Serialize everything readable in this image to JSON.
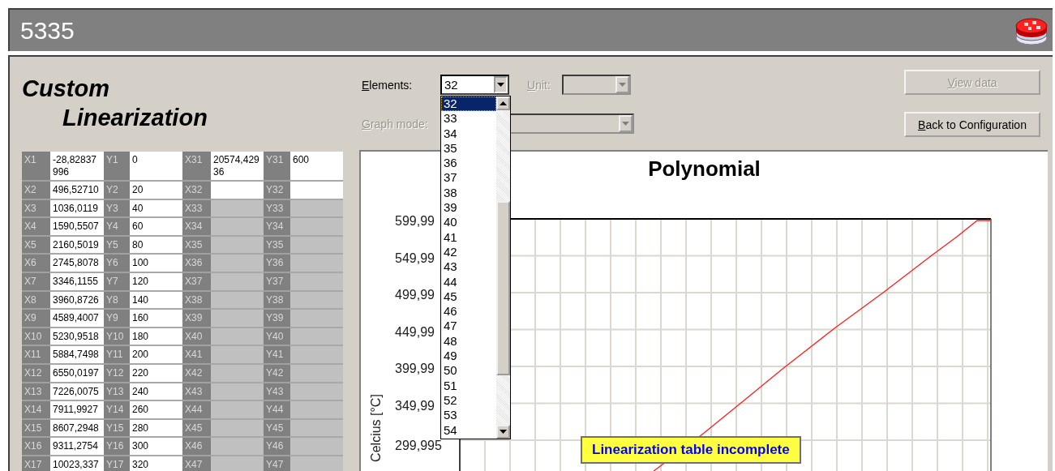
{
  "window": {
    "title": "5335"
  },
  "heading": [
    "Custom",
    "Linearization"
  ],
  "table": {
    "rows": [
      {
        "x_label": "X1",
        "x_value": "-28,82837996",
        "y_label": "Y1",
        "y_value": "0",
        "x2_label": "X31",
        "x2_value": "20574,42936",
        "y2_label": "Y31",
        "y2_value": "600",
        "right_disabled": false
      },
      {
        "x_label": "X2",
        "x_value": "496,52710",
        "y_label": "Y2",
        "y_value": "20",
        "x2_label": "X32",
        "y2_label": "Y32",
        "right_disabled": false
      },
      {
        "x_label": "X3",
        "x_value": "1036,0119",
        "y_label": "Y3",
        "y_value": "40",
        "x2_label": "X33",
        "y2_label": "Y33",
        "right_disabled": true
      },
      {
        "x_label": "X4",
        "x_value": "1590,5507",
        "y_label": "Y4",
        "y_value": "60",
        "x2_label": "X34",
        "y2_label": "Y34",
        "right_disabled": true
      },
      {
        "x_label": "X5",
        "x_value": "2160,5019",
        "y_label": "Y5",
        "y_value": "80",
        "x2_label": "X35",
        "y2_label": "Y35",
        "right_disabled": true
      },
      {
        "x_label": "X6",
        "x_value": "2745,8078",
        "y_label": "Y6",
        "y_value": "100",
        "x2_label": "X36",
        "y2_label": "Y36",
        "right_disabled": true
      },
      {
        "x_label": "X7",
        "x_value": "3346,1155",
        "y_label": "Y7",
        "y_value": "120",
        "x2_label": "X37",
        "y2_label": "Y37",
        "right_disabled": true
      },
      {
        "x_label": "X8",
        "x_value": "3960,8726",
        "y_label": "Y8",
        "y_value": "140",
        "x2_label": "X38",
        "y2_label": "Y38",
        "right_disabled": true
      },
      {
        "x_label": "X9",
        "x_value": "4589,4007",
        "y_label": "Y9",
        "y_value": "160",
        "x2_label": "X39",
        "y2_label": "Y39",
        "right_disabled": true
      },
      {
        "x_label": "X10",
        "x_value": "5230,9518",
        "y_label": "Y10",
        "y_value": "180",
        "x2_label": "X40",
        "y2_label": "Y40",
        "right_disabled": true
      },
      {
        "x_label": "X11",
        "x_value": "5884,7498",
        "y_label": "Y11",
        "y_value": "200",
        "x2_label": "X41",
        "y2_label": "Y41",
        "right_disabled": true
      },
      {
        "x_label": "X12",
        "x_value": "6550,0197",
        "y_label": "Y12",
        "y_value": "220",
        "x2_label": "X42",
        "y2_label": "Y42",
        "right_disabled": true
      },
      {
        "x_label": "X13",
        "x_value": "7226,0075",
        "y_label": "Y13",
        "y_value": "240",
        "x2_label": "X43",
        "y2_label": "Y43",
        "right_disabled": true
      },
      {
        "x_label": "X14",
        "x_value": "7911,9927",
        "y_label": "Y14",
        "y_value": "260",
        "x2_label": "X44",
        "y2_label": "Y44",
        "right_disabled": true
      },
      {
        "x_label": "X15",
        "x_value": "8607,2948",
        "y_label": "Y15",
        "y_value": "280",
        "x2_label": "X45",
        "y2_label": "Y45",
        "right_disabled": true
      },
      {
        "x_label": "X16",
        "x_value": "9311,2754",
        "y_label": "Y16",
        "y_value": "300",
        "x2_label": "X46",
        "y2_label": "Y46",
        "right_disabled": true
      },
      {
        "x_label": "X17",
        "x_value": "10023,337",
        "y_label": "Y17",
        "y_value": "320",
        "x2_label": "X47",
        "y2_label": "Y47",
        "right_disabled": true
      }
    ]
  },
  "controls": {
    "elements": {
      "label": "Elements:",
      "value": "32",
      "expanded": true,
      "options": [
        {
          "label": "32",
          "selected": true
        },
        {
          "label": "33",
          "selected": false
        },
        {
          "label": "34",
          "selected": false
        },
        {
          "label": "35",
          "selected": false
        },
        {
          "label": "36",
          "selected": false
        },
        {
          "label": "37",
          "selected": false
        },
        {
          "label": "38",
          "selected": false
        },
        {
          "label": "39",
          "selected": false
        },
        {
          "label": "40",
          "selected": false
        },
        {
          "label": "41",
          "selected": false
        },
        {
          "label": "42",
          "selected": false
        },
        {
          "label": "43",
          "selected": false
        },
        {
          "label": "44",
          "selected": false
        },
        {
          "label": "45",
          "selected": false
        },
        {
          "label": "46",
          "selected": false
        },
        {
          "label": "47",
          "selected": false
        },
        {
          "label": "48",
          "selected": false
        },
        {
          "label": "49",
          "selected": false
        },
        {
          "label": "50",
          "selected": false
        },
        {
          "label": "51",
          "selected": false
        },
        {
          "label": "52",
          "selected": false
        },
        {
          "label": "53",
          "selected": false
        },
        {
          "label": "54",
          "selected": false
        }
      ]
    },
    "unit": {
      "label": "Unit:",
      "disabled": true
    },
    "graph_mode": {
      "label": "Graph mode:",
      "disabled": true
    }
  },
  "buttons": [
    {
      "label": "View data",
      "disabled": true
    },
    {
      "label": "Back to Configuration",
      "disabled": false
    }
  ],
  "chart": {
    "title": "Polynomial",
    "ylabel": "Celcius [°C]",
    "yticks": [
      "599,99",
      "549,99",
      "499,99",
      "449,99",
      "399,99",
      "349,99",
      "299,995"
    ],
    "warning": "Linearization table incomplete"
  }
}
